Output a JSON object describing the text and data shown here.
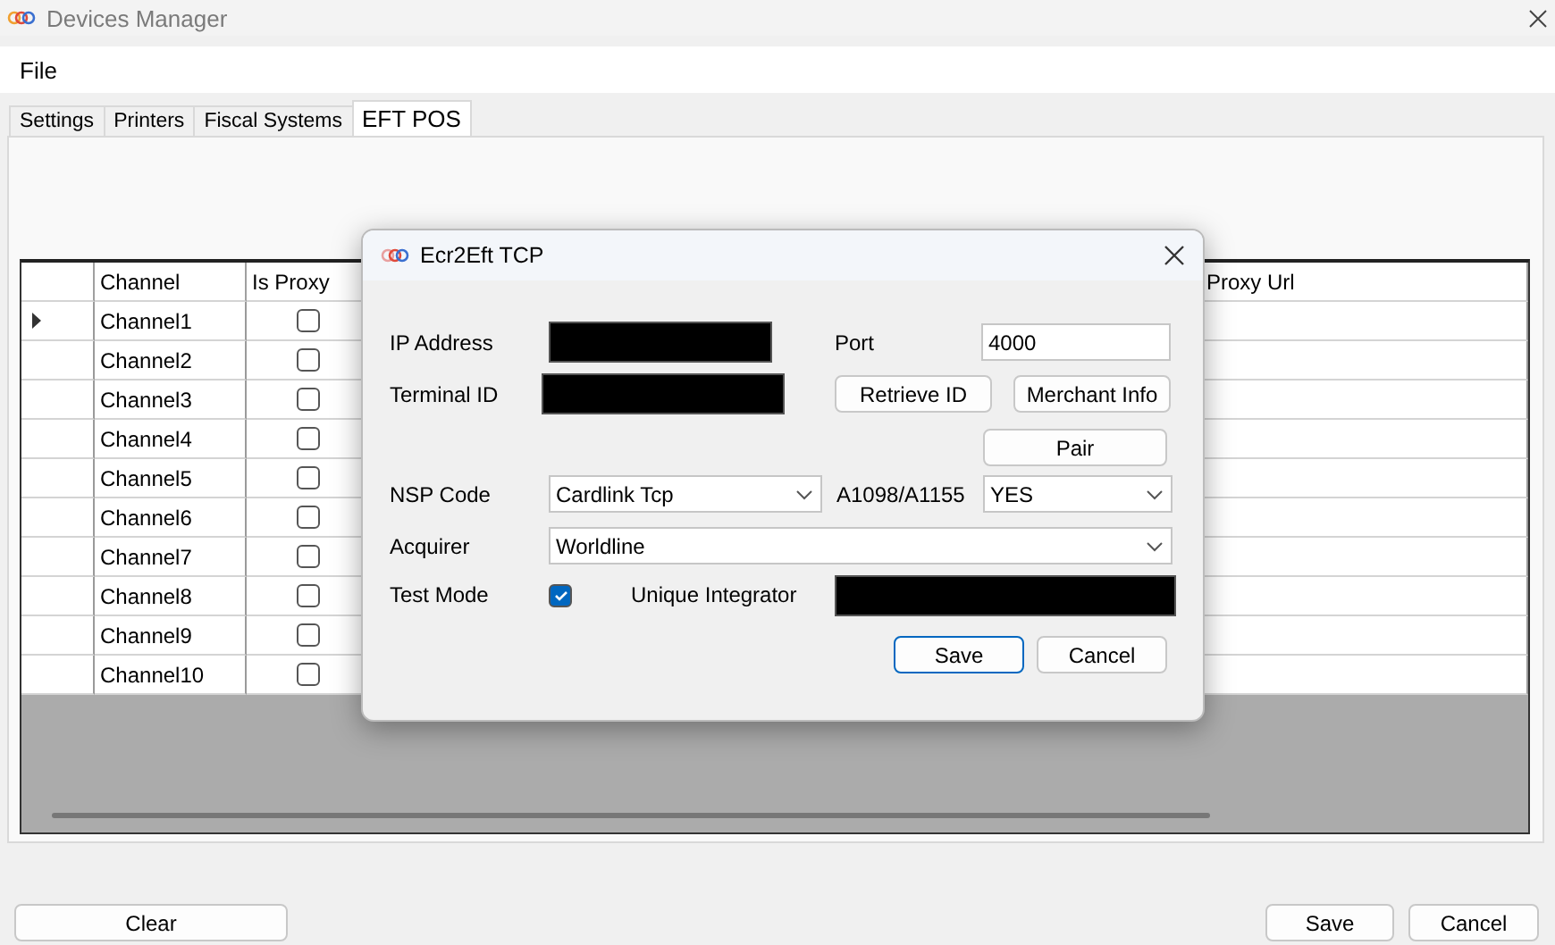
{
  "window": {
    "title": "Devices Manager"
  },
  "menu": [
    "File"
  ],
  "tabs": [
    {
      "label": "Settings",
      "selected": false
    },
    {
      "label": "Printers",
      "selected": false
    },
    {
      "label": "Fiscal Systems",
      "selected": false
    },
    {
      "label": "EFT POS",
      "selected": true
    }
  ],
  "grid": {
    "columns": [
      "Channel",
      "Is Proxy",
      "Proxy Url"
    ],
    "rows": [
      {
        "channel": "Channel1",
        "is_proxy": false,
        "current": true
      },
      {
        "channel": "Channel2",
        "is_proxy": false,
        "current": false
      },
      {
        "channel": "Channel3",
        "is_proxy": false,
        "current": false
      },
      {
        "channel": "Channel4",
        "is_proxy": false,
        "current": false
      },
      {
        "channel": "Channel5",
        "is_proxy": false,
        "current": false
      },
      {
        "channel": "Channel6",
        "is_proxy": false,
        "current": false
      },
      {
        "channel": "Channel7",
        "is_proxy": false,
        "current": false
      },
      {
        "channel": "Channel8",
        "is_proxy": false,
        "current": false
      },
      {
        "channel": "Channel9",
        "is_proxy": false,
        "current": false
      },
      {
        "channel": "Channel10",
        "is_proxy": false,
        "current": false
      }
    ]
  },
  "dialog": {
    "title": "Ecr2Eft TCP",
    "ip_address": {
      "label": "IP Address",
      "redacted": true
    },
    "port": {
      "label": "Port",
      "value": "4000"
    },
    "terminal_id": {
      "label": "Terminal ID",
      "redacted": true
    },
    "retrieve_button": "Retrieve ID",
    "merchant_button": "Merchant Info",
    "pair_button": "Pair",
    "nsp_code": {
      "label": "NSP Code",
      "value": "Cardlink Tcp"
    },
    "a1098": {
      "label": "A1098/A1155",
      "value": "YES"
    },
    "acquirer": {
      "label": "Acquirer",
      "value": "Worldline"
    },
    "test_mode": {
      "label": "Test Mode",
      "checked": true
    },
    "unique_integrator": {
      "label": "Unique Integrator",
      "redacted": true
    },
    "save": "Save",
    "cancel": "Cancel"
  },
  "footer": {
    "clear": "Clear",
    "save": "Save",
    "cancel": "Cancel"
  }
}
